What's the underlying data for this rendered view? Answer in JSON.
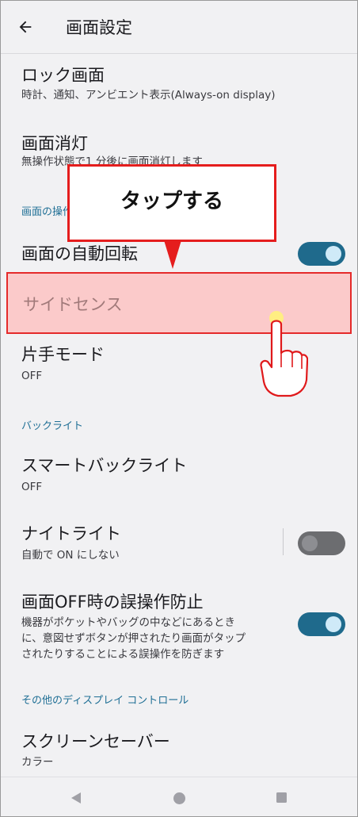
{
  "appbar": {
    "title": "画面設定",
    "back_icon": "arrow-left-icon"
  },
  "items": {
    "lock": {
      "title": "ロック画面",
      "sub": "時計、通知、アンビエント表示(Always-on display)"
    },
    "sleep": {
      "title": "画面消灯",
      "sub": "無操作状態で1 分後に画面消灯します"
    },
    "section_screen_ops": "画面の操作",
    "auto_rotate": {
      "title": "画面の自動回転",
      "toggle": "on"
    },
    "side_sense": {
      "title": "サイドセンス"
    },
    "one_hand": {
      "title": "片手モード",
      "sub": "OFF"
    },
    "section_backlight": "バックライト",
    "smart_backlight": {
      "title": "スマートバックライト",
      "sub": "OFF"
    },
    "night_light": {
      "title": "ナイトライト",
      "sub": "自動で ON にしない",
      "toggle": "off"
    },
    "mistouch": {
      "title": "画面OFF時の誤操作防止",
      "sub_lines": [
        "機器がポケットやバッグの中などにあるとき",
        "に、意図せずボタンが押されたり画面がタップ",
        "されたりすることによる誤操作を防ぎます"
      ],
      "toggle": "on"
    },
    "section_other": "その他のディスプレイ コントロール",
    "screensaver": {
      "title": "スクリーンセーバー",
      "sub": "カラー"
    }
  },
  "callout": {
    "text": "タップする"
  },
  "colors": {
    "accent": "#1f6a8c",
    "highlight_fill": "#fbcaca",
    "highlight_border": "#e52a2a",
    "section_text": "#1f6f95"
  },
  "navbar": {
    "back": "triangle-back-icon",
    "home": "circle-home-icon",
    "recents": "square-recents-icon"
  }
}
